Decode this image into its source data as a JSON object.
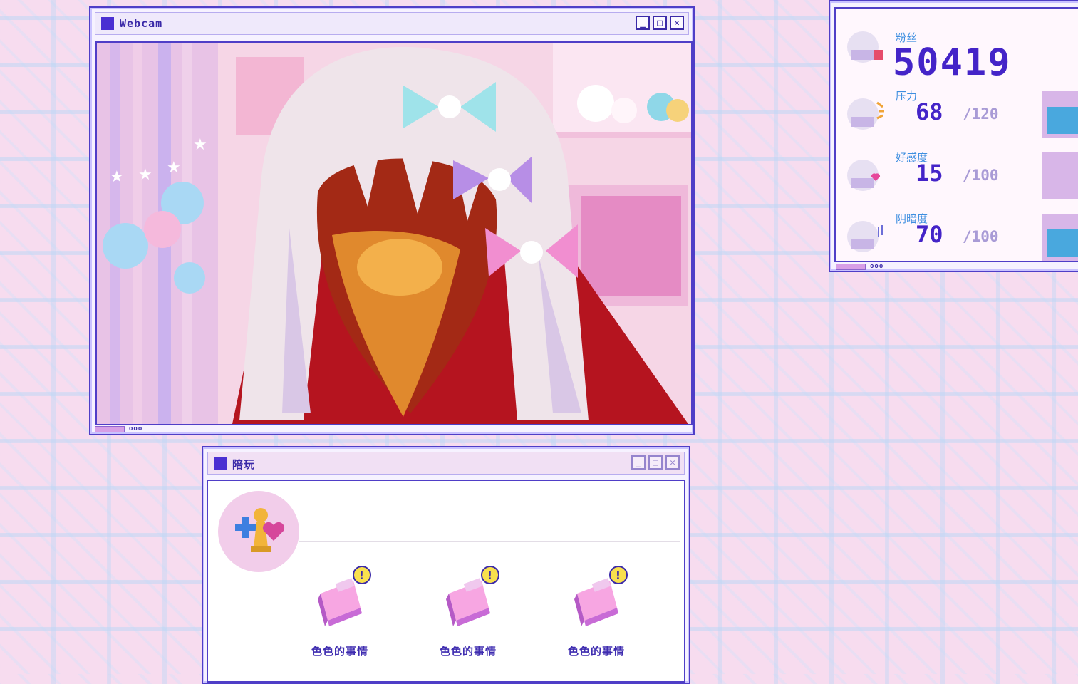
{
  "webcam_window": {
    "title": "Webcam",
    "controls": {
      "minimize": "_",
      "maximize": "□",
      "close": "✕"
    },
    "status_dots": "ooo"
  },
  "stats_window": {
    "fans": {
      "label": "粉丝",
      "value": "50419"
    },
    "stats": [
      {
        "label": "压力",
        "value": "68",
        "max": "/120"
      },
      {
        "label": "好感度",
        "value": "15",
        "max": "/100"
      },
      {
        "label": "阴暗度",
        "value": "70",
        "max": "/100"
      }
    ],
    "status_dots": "ooo"
  },
  "play_window": {
    "title": "陪玩",
    "controls": {
      "minimize": "_",
      "maximize": "□",
      "close": "✕"
    },
    "actions": [
      {
        "label": "色色的事情"
      },
      {
        "label": "色色的事情"
      },
      {
        "label": "色色的事情"
      }
    ]
  },
  "colors": {
    "window_border": "#4f3ec7",
    "title_text": "#3b2aa8",
    "value_text": "#4424c8",
    "label_text": "#3f8fe0",
    "bar_fill": "#49a8de",
    "background": "#f7dcef"
  }
}
